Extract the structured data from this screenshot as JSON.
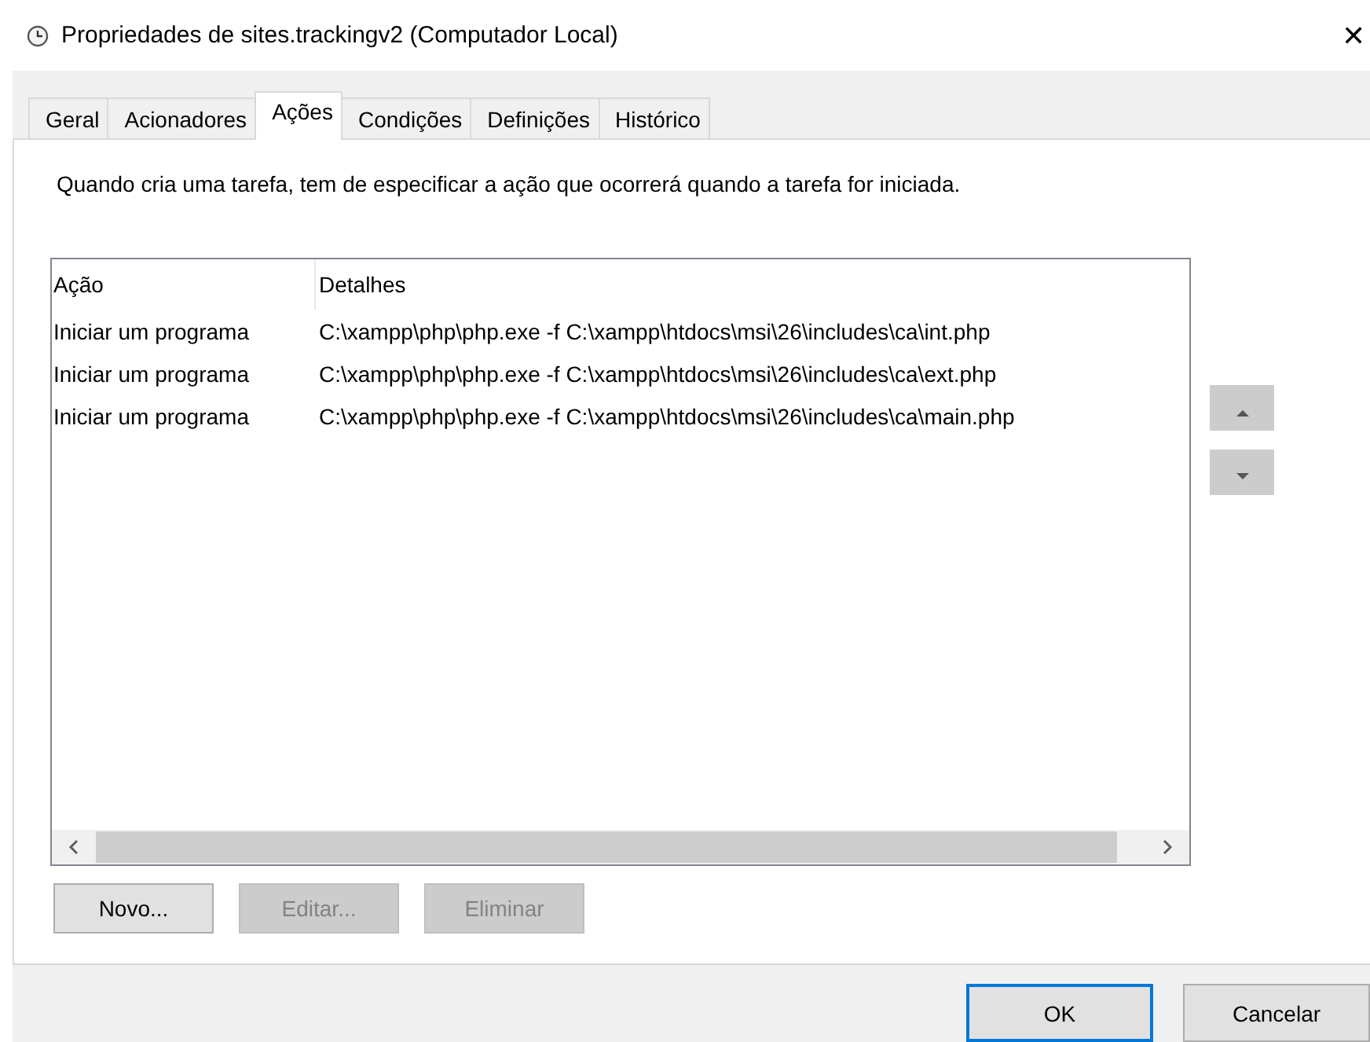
{
  "window": {
    "title": "Propriedades de sites.trackingv2 (Computador Local)",
    "close": "✕"
  },
  "tabs": [
    {
      "label": "Geral",
      "selected": false
    },
    {
      "label": "Acionadores",
      "selected": false
    },
    {
      "label": "Ações",
      "selected": true
    },
    {
      "label": "Condições",
      "selected": false
    },
    {
      "label": "Definições",
      "selected": false
    },
    {
      "label": "Histórico",
      "selected": false
    }
  ],
  "description": "Quando cria uma tarefa, tem de especificar a ação que ocorrerá quando a tarefa for iniciada.",
  "table": {
    "columns": [
      "Ação",
      "Detalhes"
    ],
    "rows": [
      {
        "cells": [
          "Iniciar um programa",
          "C:\\xampp\\php\\php.exe -f C:\\xampp\\htdocs\\msi\\26\\includes\\ca\\int.php"
        ],
        "selected": false
      },
      {
        "cells": [
          "Iniciar um programa",
          "C:\\xampp\\php\\php.exe -f C:\\xampp\\htdocs\\msi\\26\\includes\\ca\\ext.php"
        ],
        "selected": false
      },
      {
        "cells": [
          "Iniciar um programa",
          "C:\\xampp\\php\\php.exe -f C:\\xampp\\htdocs\\msi\\26\\includes\\ca\\main.php"
        ],
        "selected": false
      }
    ]
  },
  "action_buttons": [
    {
      "label": "Novo...",
      "disabled": false
    },
    {
      "label": "Editar...",
      "disabled": true
    },
    {
      "label": "Eliminar",
      "disabled": true
    }
  ],
  "dialog_buttons": [
    {
      "label": "OK",
      "default": true
    },
    {
      "label": "Cancelar",
      "default": false
    }
  ]
}
